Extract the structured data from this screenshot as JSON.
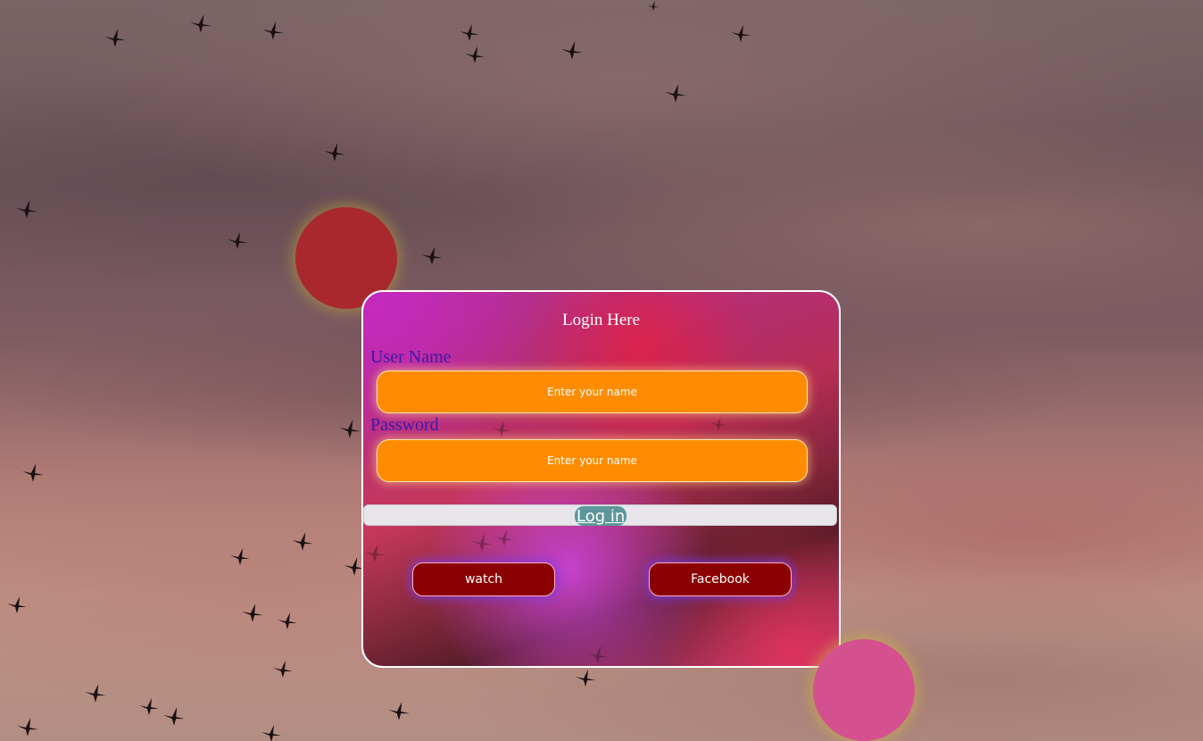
{
  "login_card": {
    "title": "Login Here",
    "username_label": "User Name",
    "username_placeholder": "Enter your name",
    "password_label": "Password",
    "password_placeholder": "Enter your name",
    "login_button": "Log in",
    "watch_button": "watch",
    "facebook_button": "Facebook"
  },
  "colors": {
    "input_background": "#ff8c00",
    "social_button_background": "#8b0000",
    "label_color": "#3a1aa8",
    "login_button_background": "#5e969a"
  }
}
